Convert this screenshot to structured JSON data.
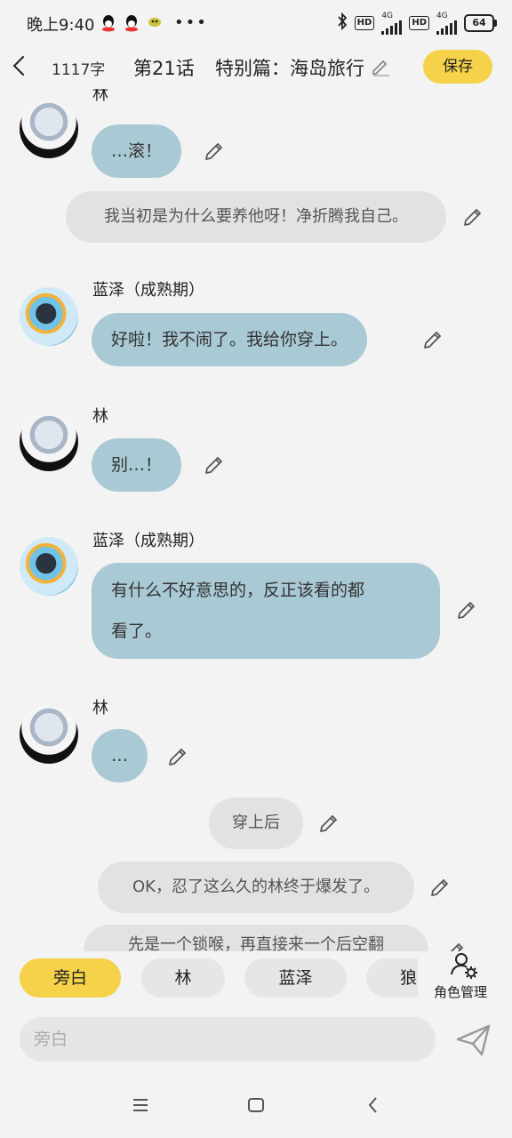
{
  "status": {
    "time": "晚上9:40",
    "net1": "4G",
    "net2": "4G",
    "hd": "HD",
    "battery": "64"
  },
  "header": {
    "word_count": "1117字",
    "chapter": "第21话",
    "title": "特别篇：海岛旅行",
    "save_label": "保存"
  },
  "chat": {
    "partial_name": "林",
    "msg1": "…滚！",
    "narr1": "我当初是为什么要养他呀！净折腾我自己。",
    "name2": "蓝泽（成熟期）",
    "msg2": "好啦！我不闹了。我给你穿上。",
    "name3": "林",
    "msg3": "别…！",
    "name4": "蓝泽（成熟期）",
    "msg4_line1": "有什么不好意思的，反正该看的都",
    "msg4_line2": "看了。",
    "name5": "林",
    "msg5": "…",
    "narr2": "穿上后",
    "narr3": "OK，忍了这么久的林终于爆发了。",
    "narr4": "先是一个锁喉，再直接来一个后空翻"
  },
  "chips": [
    "旁白",
    "林",
    "蓝泽",
    "狼"
  ],
  "role_manager_label": "角色管理",
  "input": {
    "placeholder": "旁白"
  },
  "colors": {
    "accent": "#f6d24a",
    "bubble": "#a9c9d4",
    "narration": "#e2e2e2"
  }
}
